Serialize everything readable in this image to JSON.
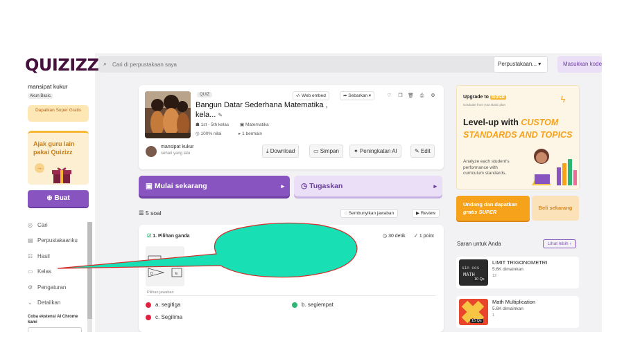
{
  "brand": {
    "logo": "QUIZIZZ",
    "accent": "#8854c0",
    "logo_color": "#46113c"
  },
  "user": {
    "name": "mansipat kukur",
    "plan": "Akun Basic",
    "super_cta": "Dapatkan Super Gratis"
  },
  "sidebar": {
    "invite_title": "Ajak guru lain pakai Quizizz",
    "create_label": "Buat",
    "items": [
      {
        "label": "Cari",
        "icon": "compass-icon"
      },
      {
        "label": "Perpustakaanku",
        "icon": "library-icon"
      },
      {
        "label": "Hasil",
        "icon": "results-icon"
      },
      {
        "label": "Kelas",
        "icon": "classes-icon"
      },
      {
        "label": "Pengaturan",
        "icon": "gear-icon"
      },
      {
        "label": "Detailkan",
        "icon": "chevron-down-icon"
      }
    ],
    "chrome_ext": "Coba ekstensi AI Chrome kami"
  },
  "topbar": {
    "search_placeholder": "Cari di perpustakaan saya",
    "library_select": "Perpustakaan...",
    "join_label": "Masukkan kode"
  },
  "quiz": {
    "badge": "QUIZ",
    "title": "Bangun Datar Sederhana Matematika , kela...",
    "grade": "1st - 5th kelas",
    "subject": "Matematika",
    "accuracy": "100% nilai",
    "players": "1 bermain",
    "embed_label": "Web embed",
    "share_label": "Sebarkan",
    "owner_name": "mansipat kukur",
    "owner_time": "sehari yang lalu",
    "actions": {
      "download": "Download",
      "save": "Simpan",
      "ai": "Peningkatan AI",
      "edit": "Edit"
    }
  },
  "main": {
    "start_label": "Mulai sekarang",
    "assign_label": "Tugaskan",
    "question_count": "5 soal",
    "hide_answers": "Sembunyikan jawaban",
    "review": "Review"
  },
  "question": {
    "type": "1. Pilihan ganda",
    "time": "30 detik",
    "points": "1 point",
    "options_label": "Pilihan jawaban",
    "options": [
      {
        "label": "a. segitiga",
        "color": "#e0213f"
      },
      {
        "label": "b. segiempat",
        "color": "#2bb673"
      },
      {
        "label": "c. Segilima",
        "color": "#e0213f"
      }
    ],
    "shape_labels": [
      "D",
      "E"
    ]
  },
  "promo": {
    "upgrade_prefix": "Upgrade to",
    "super_tag": "SUPER",
    "sub": "Graduate from your Basic plan",
    "headline_plain": "Level-up with ",
    "headline_highlight": "CUSTOM STANDARDS AND TOPICS",
    "body": "Analyze each student's performance with curriculum standards.",
    "invite_btn_line1": "Undang dan dapatkan",
    "invite_btn_line2": "gratis SUPER",
    "buy_btn": "Beli sekarang"
  },
  "suggestions": {
    "title": "Saran untuk Anda",
    "see_more": "Lihat lebih",
    "items": [
      {
        "name": "LIMIT TRIGONOMETRI",
        "plays": "5.6K dimainkan",
        "count": "12",
        "qs": "10 Qs"
      },
      {
        "name": "Math Multiplication",
        "plays": "5.6K dimainkan",
        "count": "1",
        "qs": "15 Qs"
      }
    ]
  },
  "annotation": {
    "fill": "#19e0b4",
    "stroke": "#d42a2a"
  }
}
